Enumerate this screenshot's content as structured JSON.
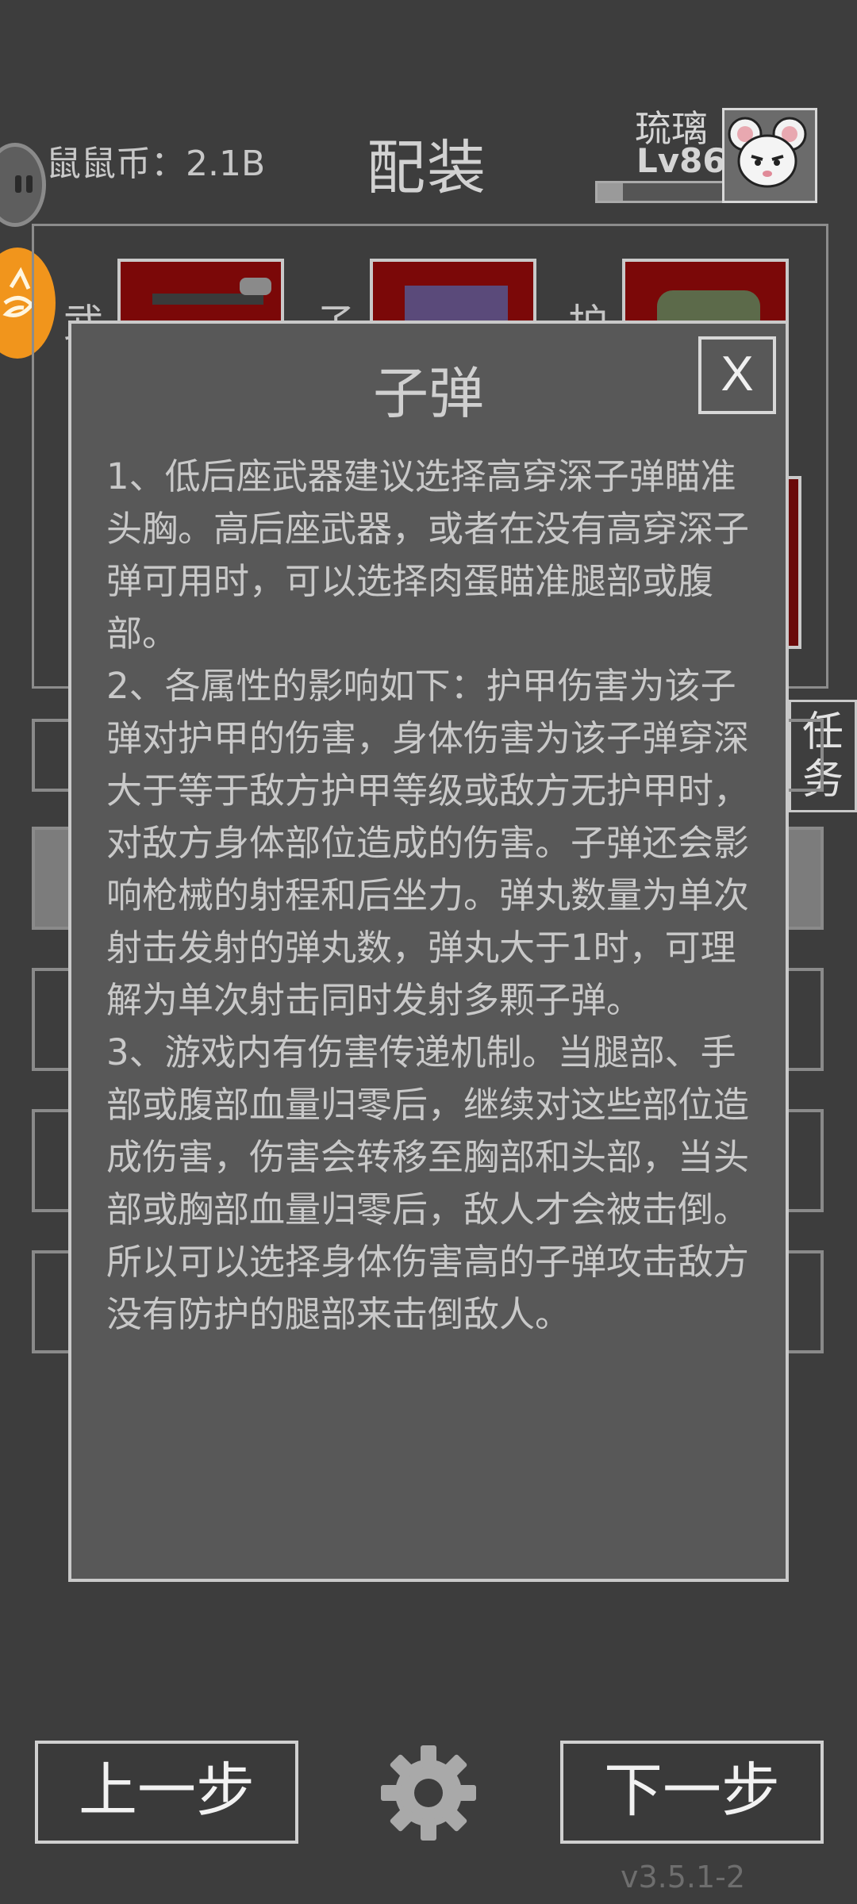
{
  "header": {
    "coins_label": "鼠鼠币：2.1B",
    "title": "配装",
    "player_name": "琉璃",
    "player_level": "Lv86",
    "xp_progress": 0.2
  },
  "equipment": {
    "slot_labels": [
      "武",
      "子",
      "护"
    ]
  },
  "side": {
    "quest_tab": "任务"
  },
  "modal": {
    "title": "子弹",
    "close_label": "X",
    "paragraphs": [
      "1、低后座武器建议选择高穿深子弹瞄准头胸。高后座武器，或者在没有高穿深子弹可用时，可以选择肉蛋瞄准腿部或腹部。",
      "2、各属性的影响如下：护甲伤害为该子弹对护甲的伤害，身体伤害为该子弹穿深大于等于敌方护甲等级或敌方无护甲时，对敌方身体部位造成的伤害。子弹还会影响枪械的射程和后坐力。弹丸数量为单次射击发射的弹丸数，弹丸大于1时，可理解为单次射击同时发射多颗子弹。",
      "3、游戏内有伤害传递机制。当腿部、手部或腹部血量归零后，继续对这些部位造成伤害，伤害会转移至胸部和头部，当头部或胸部血量归零后，敌人才会被击倒。所以可以选择身体伤害高的子弹攻击敌方没有防护的腿部来击倒敌人。"
    ]
  },
  "footer": {
    "prev_label": "上一步",
    "next_label": "下一步",
    "version": "v3.5.1-2"
  },
  "icons": {
    "settings": "gear-icon",
    "avatar": "mouse-avatar",
    "left_top": "robot-face-icon",
    "left_orange": "orange-mascot-icon"
  }
}
